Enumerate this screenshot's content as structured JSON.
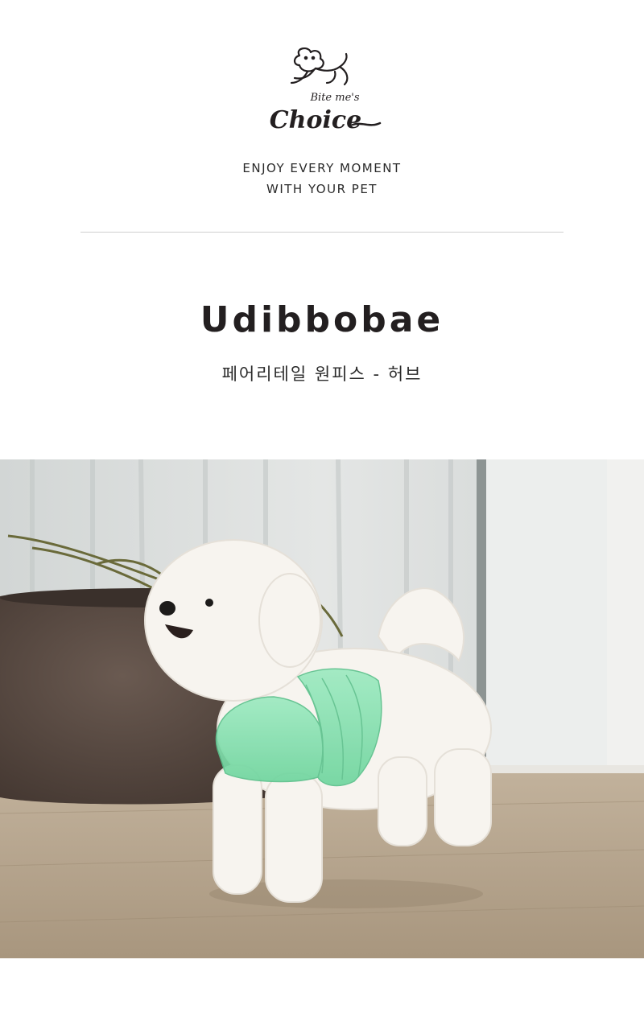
{
  "brand": {
    "logo_small": "Bite me's",
    "logo_main": "Choice",
    "tagline_line1": "ENJOY EVERY MOMENT",
    "tagline_line2": "WITH YOUR PET"
  },
  "product": {
    "title": "Udibbobae",
    "subtitle": "페어리테일 원피스 - 허브"
  },
  "photo": {
    "icon": "product-photo",
    "colors": {
      "curtain": "#d9dcdb",
      "floor": "#b9a68e",
      "pot": "#5b4b43",
      "dress": "#86e0b0",
      "dog": "#f7f4ef"
    }
  }
}
